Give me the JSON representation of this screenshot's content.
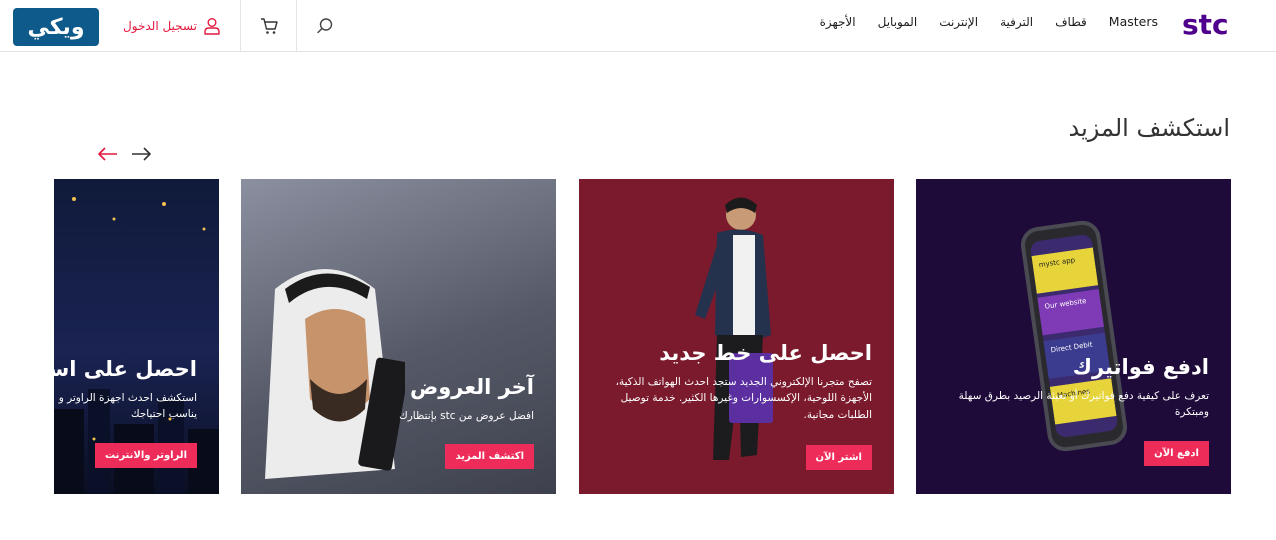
{
  "header": {
    "brand_logo": "stc",
    "nav": [
      {
        "label": "الأجهزة"
      },
      {
        "label": "الموبايل"
      },
      {
        "label": "الإنترنت"
      },
      {
        "label": "الترفية"
      },
      {
        "label": "قطاف"
      },
      {
        "label": "Masters"
      }
    ],
    "login_label": "تسجيل الدخول",
    "partner_logo": "ويكي"
  },
  "section": {
    "title": "استكشف المزيد"
  },
  "cards": [
    {
      "title": "ادفع فواتيرك",
      "description": "تعرف على كيفية دفع فواتيرك أو تعبئة الرصيد بطرق سهلة ومبتكرة",
      "button": "ادفع الآن",
      "phone_rows": [
        "mystc app",
        "Our website",
        "Direct Debit",
        "Machines"
      ]
    },
    {
      "title": "احصل على خط جديد",
      "description": "تصفح متجرنا الإلكتروني الجديد ستجد احدث الهواتف الذكية، الأجهزة اللوحية، الإكسسوارات وغيرها الكثير. خدمة توصيل الطلبات مجانية.",
      "button": "اشتر الآن"
    },
    {
      "title": "آخر العروض",
      "description": "افضل عروض من stc بإنتظارك",
      "button": "اكتشف المزيد"
    },
    {
      "title": "احصل على اسرع",
      "description": "استكشف احدث اجهزة الراوتر و يناسب احتياجك",
      "button": "الراوتر والانترنت"
    }
  ],
  "colors": {
    "accent": "#ee2c5a",
    "brand_purple": "#4f008c",
    "login_red": "#e2183e"
  },
  "icons": {
    "search": "search-icon",
    "cart": "cart-icon",
    "user": "user-icon",
    "arrow_left": "arrow-left-icon",
    "arrow_right": "arrow-right-icon"
  }
}
